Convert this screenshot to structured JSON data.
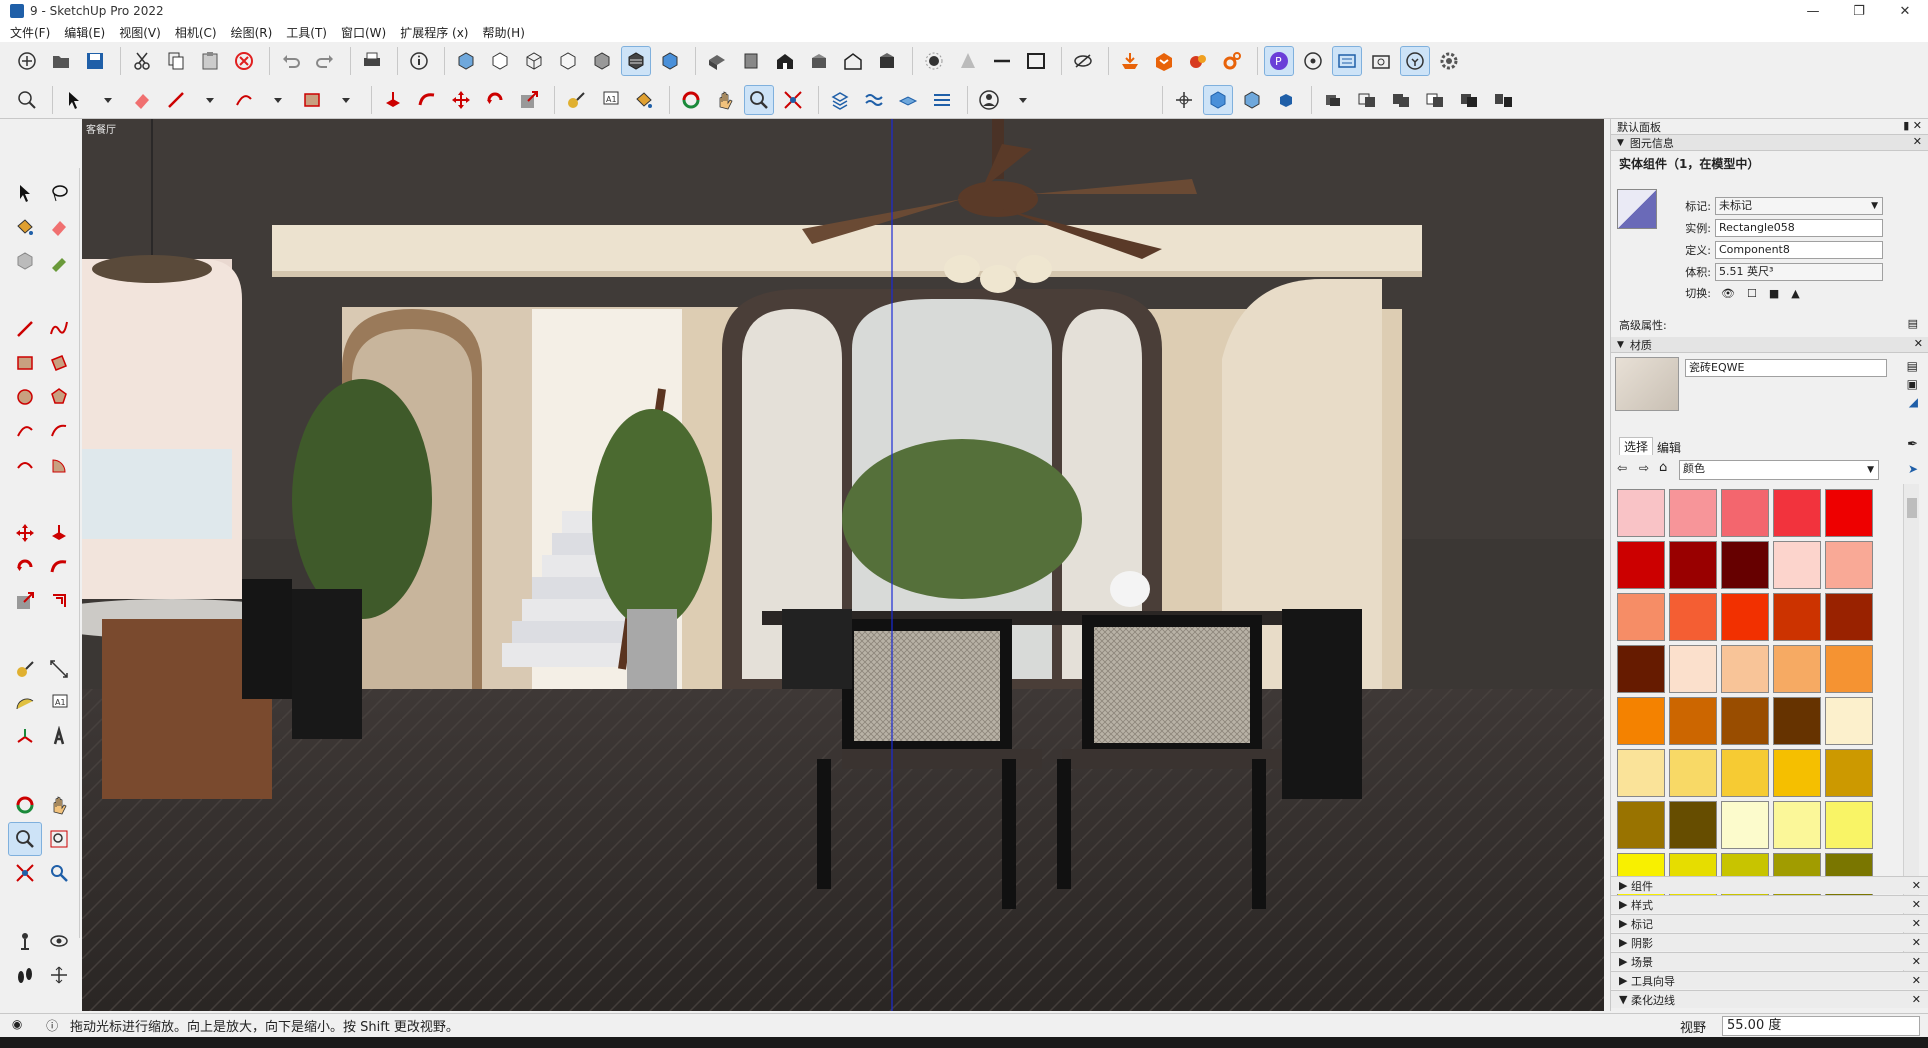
{
  "window": {
    "title": "9 - SketchUp Pro 2022",
    "controls": [
      "minimize-icon",
      "restore-icon",
      "close-icon"
    ]
  },
  "menu": [
    "文件(F)",
    "编辑(E)",
    "视图(V)",
    "相机(C)",
    "绘图(R)",
    "工具(T)",
    "窗口(W)",
    "扩展程序 (x)",
    "帮助(H)"
  ],
  "viewport": {
    "scene_label": "客餐厅"
  },
  "right_panel": {
    "tray_title": "默认面板",
    "entity_info": {
      "header": "图元信息",
      "title": "实体组件（1，在模型中）",
      "tag_label": "标记:",
      "tag_value": "未标记",
      "instance_label": "实例:",
      "instance_value": "Rectangle058",
      "definition_label": "定义:",
      "definition_value": "Component8",
      "volume_label": "体积:",
      "volume_value": "5.51 英尺³",
      "toggles_label": "切换:",
      "advanced_label": "高级属性:"
    },
    "materials": {
      "header": "材质",
      "material_name": "瓷砖EQWE",
      "tab_select": "选择",
      "tab_edit": "编辑",
      "library": "颜色",
      "colors": [
        "#f9c3c6",
        "#f79599",
        "#f3666e",
        "#f2333d",
        "#ee0000",
        "#cc0000",
        "#990000",
        "#660000",
        "#fcd4cc",
        "#f9a996",
        "#f68d66",
        "#f45e33",
        "#f23000",
        "#cc3300",
        "#992200",
        "#661b00",
        "#fbe0cc",
        "#f8c498",
        "#f6aa63",
        "#f59332",
        "#f48200",
        "#cc6600",
        "#994d00",
        "#663300",
        "#fcf0cc",
        "#fae399",
        "#f8d966",
        "#f6cb33",
        "#f5bf00",
        "#cc9900",
        "#997300",
        "#664d00",
        "#fcfbcc",
        "#fbf799",
        "#f9f466",
        "#f8f000",
        "#e6dd00",
        "#c8c400",
        "#a19c00",
        "#7a7600"
      ]
    },
    "collapsed_sections": [
      "组件",
      "样式",
      "标记",
      "阴影",
      "场景",
      "工具向导",
      "柔化边线"
    ]
  },
  "status": {
    "message": "拖动光标进行缩放。向上是放大，向下是缩小。按 Shift 更改视野。",
    "vcb_label": "视野",
    "vcb_value": "55.00 度"
  }
}
